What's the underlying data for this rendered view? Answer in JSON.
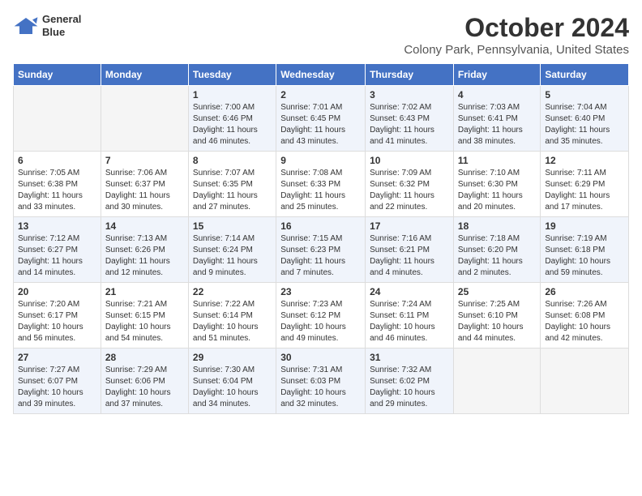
{
  "header": {
    "logo_line1": "General",
    "logo_line2": "Blue",
    "month": "October 2024",
    "location": "Colony Park, Pennsylvania, United States"
  },
  "days_of_week": [
    "Sunday",
    "Monday",
    "Tuesday",
    "Wednesday",
    "Thursday",
    "Friday",
    "Saturday"
  ],
  "weeks": [
    [
      {
        "day": "",
        "info": ""
      },
      {
        "day": "",
        "info": ""
      },
      {
        "day": "1",
        "info": "Sunrise: 7:00 AM\nSunset: 6:46 PM\nDaylight: 11 hours and 46 minutes."
      },
      {
        "day": "2",
        "info": "Sunrise: 7:01 AM\nSunset: 6:45 PM\nDaylight: 11 hours and 43 minutes."
      },
      {
        "day": "3",
        "info": "Sunrise: 7:02 AM\nSunset: 6:43 PM\nDaylight: 11 hours and 41 minutes."
      },
      {
        "day": "4",
        "info": "Sunrise: 7:03 AM\nSunset: 6:41 PM\nDaylight: 11 hours and 38 minutes."
      },
      {
        "day": "5",
        "info": "Sunrise: 7:04 AM\nSunset: 6:40 PM\nDaylight: 11 hours and 35 minutes."
      }
    ],
    [
      {
        "day": "6",
        "info": "Sunrise: 7:05 AM\nSunset: 6:38 PM\nDaylight: 11 hours and 33 minutes."
      },
      {
        "day": "7",
        "info": "Sunrise: 7:06 AM\nSunset: 6:37 PM\nDaylight: 11 hours and 30 minutes."
      },
      {
        "day": "8",
        "info": "Sunrise: 7:07 AM\nSunset: 6:35 PM\nDaylight: 11 hours and 27 minutes."
      },
      {
        "day": "9",
        "info": "Sunrise: 7:08 AM\nSunset: 6:33 PM\nDaylight: 11 hours and 25 minutes."
      },
      {
        "day": "10",
        "info": "Sunrise: 7:09 AM\nSunset: 6:32 PM\nDaylight: 11 hours and 22 minutes."
      },
      {
        "day": "11",
        "info": "Sunrise: 7:10 AM\nSunset: 6:30 PM\nDaylight: 11 hours and 20 minutes."
      },
      {
        "day": "12",
        "info": "Sunrise: 7:11 AM\nSunset: 6:29 PM\nDaylight: 11 hours and 17 minutes."
      }
    ],
    [
      {
        "day": "13",
        "info": "Sunrise: 7:12 AM\nSunset: 6:27 PM\nDaylight: 11 hours and 14 minutes."
      },
      {
        "day": "14",
        "info": "Sunrise: 7:13 AM\nSunset: 6:26 PM\nDaylight: 11 hours and 12 minutes."
      },
      {
        "day": "15",
        "info": "Sunrise: 7:14 AM\nSunset: 6:24 PM\nDaylight: 11 hours and 9 minutes."
      },
      {
        "day": "16",
        "info": "Sunrise: 7:15 AM\nSunset: 6:23 PM\nDaylight: 11 hours and 7 minutes."
      },
      {
        "day": "17",
        "info": "Sunrise: 7:16 AM\nSunset: 6:21 PM\nDaylight: 11 hours and 4 minutes."
      },
      {
        "day": "18",
        "info": "Sunrise: 7:18 AM\nSunset: 6:20 PM\nDaylight: 11 hours and 2 minutes."
      },
      {
        "day": "19",
        "info": "Sunrise: 7:19 AM\nSunset: 6:18 PM\nDaylight: 10 hours and 59 minutes."
      }
    ],
    [
      {
        "day": "20",
        "info": "Sunrise: 7:20 AM\nSunset: 6:17 PM\nDaylight: 10 hours and 56 minutes."
      },
      {
        "day": "21",
        "info": "Sunrise: 7:21 AM\nSunset: 6:15 PM\nDaylight: 10 hours and 54 minutes."
      },
      {
        "day": "22",
        "info": "Sunrise: 7:22 AM\nSunset: 6:14 PM\nDaylight: 10 hours and 51 minutes."
      },
      {
        "day": "23",
        "info": "Sunrise: 7:23 AM\nSunset: 6:12 PM\nDaylight: 10 hours and 49 minutes."
      },
      {
        "day": "24",
        "info": "Sunrise: 7:24 AM\nSunset: 6:11 PM\nDaylight: 10 hours and 46 minutes."
      },
      {
        "day": "25",
        "info": "Sunrise: 7:25 AM\nSunset: 6:10 PM\nDaylight: 10 hours and 44 minutes."
      },
      {
        "day": "26",
        "info": "Sunrise: 7:26 AM\nSunset: 6:08 PM\nDaylight: 10 hours and 42 minutes."
      }
    ],
    [
      {
        "day": "27",
        "info": "Sunrise: 7:27 AM\nSunset: 6:07 PM\nDaylight: 10 hours and 39 minutes."
      },
      {
        "day": "28",
        "info": "Sunrise: 7:29 AM\nSunset: 6:06 PM\nDaylight: 10 hours and 37 minutes."
      },
      {
        "day": "29",
        "info": "Sunrise: 7:30 AM\nSunset: 6:04 PM\nDaylight: 10 hours and 34 minutes."
      },
      {
        "day": "30",
        "info": "Sunrise: 7:31 AM\nSunset: 6:03 PM\nDaylight: 10 hours and 32 minutes."
      },
      {
        "day": "31",
        "info": "Sunrise: 7:32 AM\nSunset: 6:02 PM\nDaylight: 10 hours and 29 minutes."
      },
      {
        "day": "",
        "info": ""
      },
      {
        "day": "",
        "info": ""
      }
    ]
  ]
}
